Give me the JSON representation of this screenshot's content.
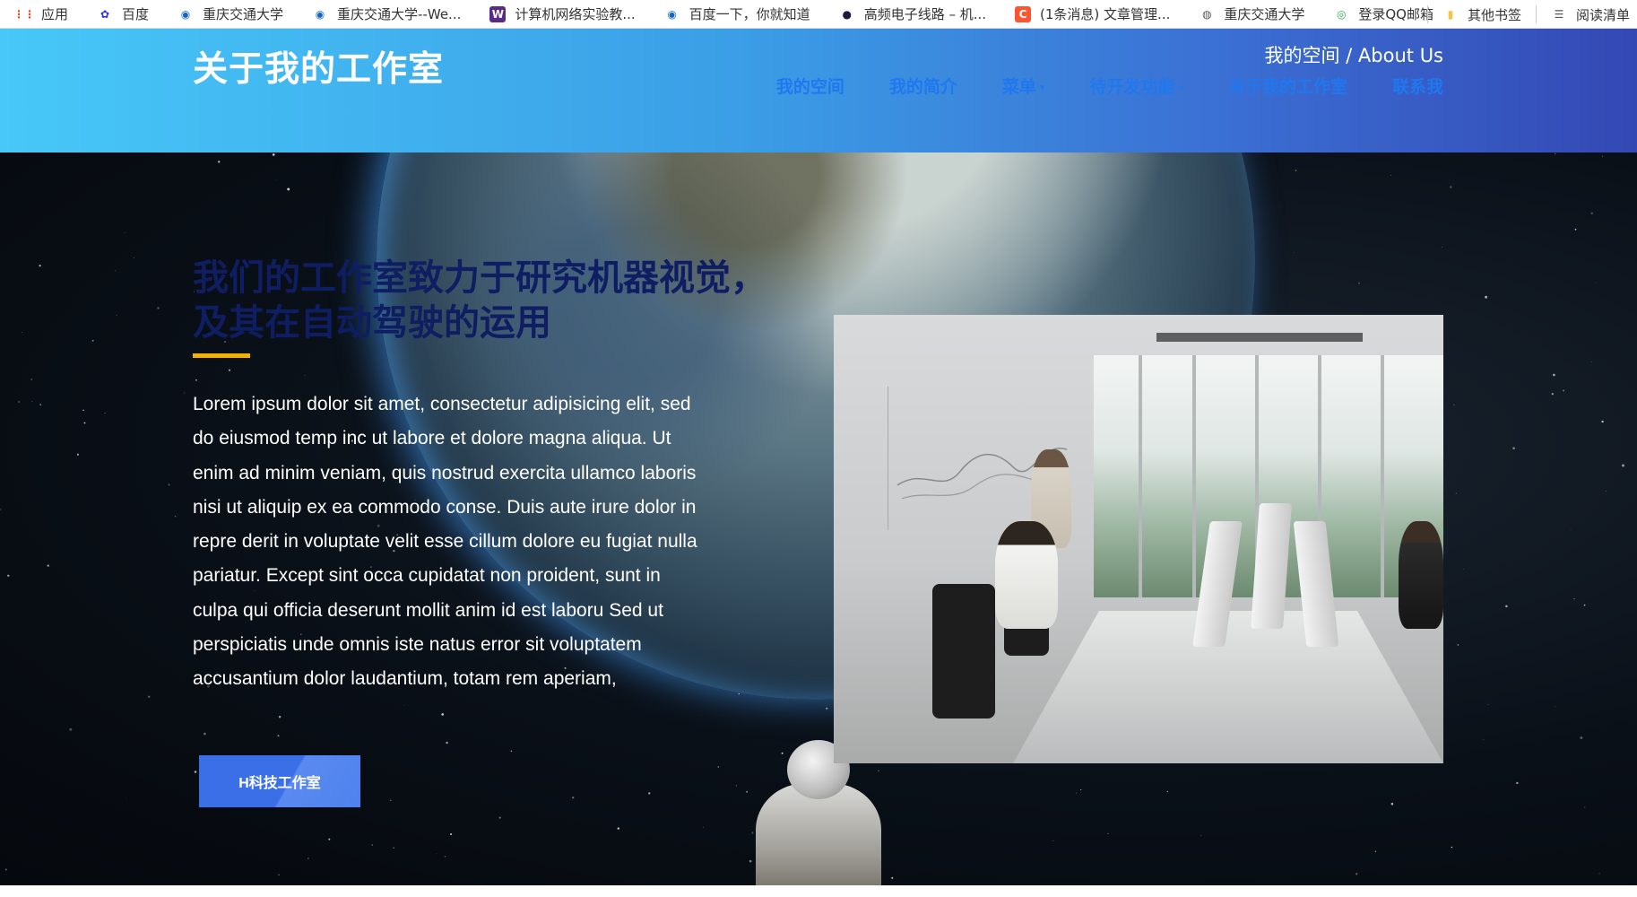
{
  "bookmarks": [
    {
      "label": "应用",
      "icon": "apps-grid-icon",
      "color": "#ea4335"
    },
    {
      "label": "百度",
      "icon": "baidu-paw-icon",
      "color": "#2932e1"
    },
    {
      "label": "重庆交通大学",
      "icon": "university-globe-icon",
      "color": "#1565c0"
    },
    {
      "label": "重庆交通大学--We...",
      "icon": "university-globe-icon",
      "color": "#1565c0"
    },
    {
      "label": "计算机网络实验教...",
      "icon": "w-logo-icon",
      "color": "#5b2a86"
    },
    {
      "label": "百度一下，你就知道",
      "icon": "university-globe-icon",
      "color": "#1565c0"
    },
    {
      "label": "高频电子线路 – 机...",
      "icon": "dark-circle-icon",
      "color": "#1a1a40"
    },
    {
      "label": "(1条消息) 文章管理...",
      "icon": "csdn-c-icon",
      "color": "#fc5531"
    },
    {
      "label": "重庆交通大学",
      "icon": "globe-icon",
      "color": "#555555"
    },
    {
      "label": "登录QQ邮箱",
      "icon": "chrome-like-icon",
      "color": "#34a853"
    }
  ],
  "bookmarks_right": [
    {
      "label": "其他书签",
      "icon": "folder-icon",
      "color": "#f6c343"
    },
    {
      "label": "阅读清单",
      "icon": "reading-list-icon",
      "color": "#555555"
    }
  ],
  "header": {
    "site_title": "关于我的工作室",
    "breadcrumb": "我的空间 / About Us",
    "nav": [
      {
        "label": "我的空间",
        "dropdown": false
      },
      {
        "label": "我的简介",
        "dropdown": false
      },
      {
        "label": "菜单",
        "dropdown": true
      },
      {
        "label": "待开发功能",
        "dropdown": true
      },
      {
        "label": "关于我的工作室",
        "dropdown": false
      },
      {
        "label": "联系我",
        "dropdown": false
      }
    ]
  },
  "hero": {
    "headline": "我们的工作室致力于研究机器视觉，及其在自动驾驶的运用",
    "body": "Lorem ipsum dolor sit amet, consectetur adipisicing elit, sed do eiusmod temp inc ut labore et dolore magna aliqua. Ut enim ad minim veniam, quis nostrud exercita ullamco laboris nisi ut aliquip ex ea commodo conse. Duis aute irure dolor in repre derit in voluptate velit esse cillum dolore eu fugiat nulla pariatur. Except sint occa cupidatat non proident, sunt in culpa qui officia deserunt mollit anim id est laboru Sed ut perspiciatis unde omnis iste natus error sit voluptatem accusantium dolor laudantium, totam rem aperiam,",
    "cta_label": "H科技工作室"
  },
  "colors": {
    "header_gradient": [
      "#47c8f8",
      "#3448b4"
    ],
    "nav_text": "#1f78f0",
    "headline": "#0f1e63",
    "accent": "#f5b100",
    "cta": "#3a6fe8"
  }
}
